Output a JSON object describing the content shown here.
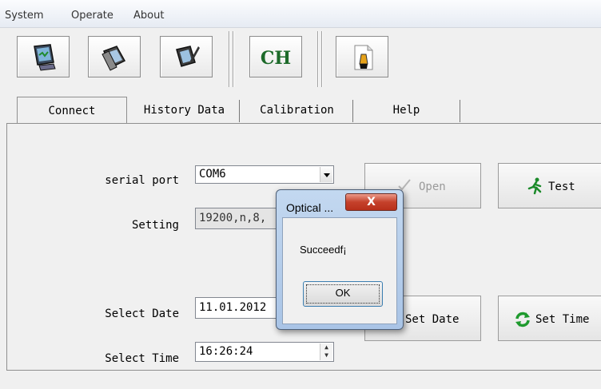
{
  "menu": {
    "items": [
      "System",
      "Operate",
      "About"
    ]
  },
  "toolbar": {
    "ch_label": "CH"
  },
  "tabs": [
    "Connect",
    "History Data",
    "Calibration",
    "Help"
  ],
  "connect": {
    "serial_port_label": "serial port",
    "serial_port_value": "COM6",
    "setting_label": "Setting",
    "setting_value": "19200,n,8,",
    "select_date_label": "Select Date",
    "select_date_value": "11.01.2012",
    "select_time_label": "Select Time",
    "select_time_value": "16:26:24",
    "open_button": "Open",
    "test_button": "Test",
    "set_date_button": "Set Date",
    "set_time_button": "Set Time"
  },
  "dialog": {
    "title": "Optical ...",
    "message": "Succeedf¡",
    "ok_button": "OK",
    "close_glyph": "X"
  }
}
